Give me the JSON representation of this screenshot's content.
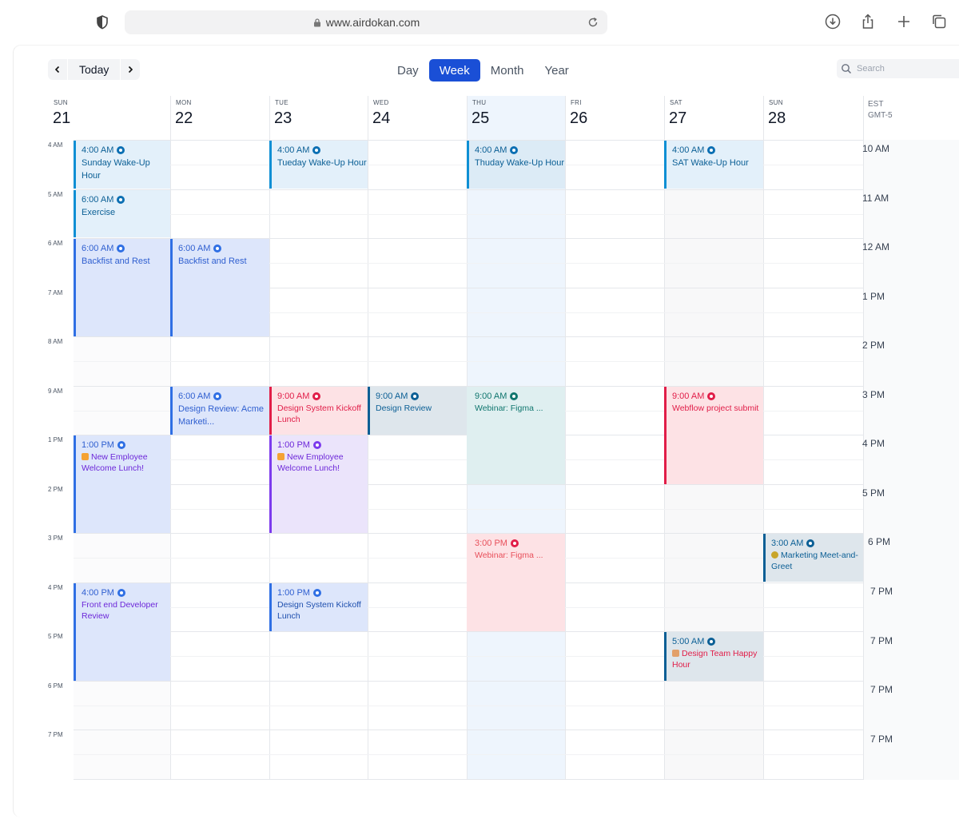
{
  "browser": {
    "url": "www.airdokan.com"
  },
  "toolbar": {
    "today_label": "Today",
    "views": [
      "Day",
      "Week",
      "Month",
      "Year"
    ],
    "active_view": "Week",
    "search_placeholder": "Search"
  },
  "days": [
    {
      "name": "SUN",
      "num": "21"
    },
    {
      "name": "MON",
      "num": "22"
    },
    {
      "name": "TUE",
      "num": "23"
    },
    {
      "name": "WED",
      "num": "24"
    },
    {
      "name": "THU",
      "num": "25"
    },
    {
      "name": "FRI",
      "num": "26"
    },
    {
      "name": "SAT",
      "num": "27"
    },
    {
      "name": "SUN",
      "num": "28"
    }
  ],
  "timezone": {
    "name": "EST",
    "offset": "GMT-5"
  },
  "time_labels": [
    "4 AM",
    "5 AM",
    "6 AM",
    "7 AM",
    "8 AM",
    "9 AM",
    "1 PM",
    "2 PM",
    "3 PM",
    "4 PM",
    "5 PM",
    "6 PM",
    "7 PM"
  ],
  "est_labels": [
    "10 AM",
    "11 AM",
    "12 AM",
    "1 PM",
    "2 PM",
    "3 PM",
    "4 PM",
    "5 PM",
    "6 PM",
    "7 PM",
    "7 PM",
    "7 PM",
    "7 PM"
  ],
  "events": [
    {
      "time": "4:00 AM",
      "title": "Sunday Wake-Up Hour"
    },
    {
      "time": "6:00 AM",
      "title": "Exercise"
    },
    {
      "time": "6:00 AM",
      "title": "Backfist and Rest"
    },
    {
      "time": "6:00 AM",
      "title": "Backfist and Rest"
    },
    {
      "time": "4:00 AM",
      "title": "Tueday Wake-Up Hour"
    },
    {
      "time": "4:00 AM",
      "title": "Thuday Wake-Up Hour"
    },
    {
      "time": "4:00 AM",
      "title": "SAT Wake-Up Hour"
    },
    {
      "time": "6:00 AM",
      "title": "Design Review: Acme Marketi..."
    },
    {
      "time": "9:00 AM",
      "title": "Design System Kickoff Lunch"
    },
    {
      "time": "9:00 AM",
      "title": "Design Review"
    },
    {
      "time": "9:00 AM",
      "title": "Webinar: Figma ..."
    },
    {
      "time": "9:00 AM",
      "title": "Webflow project submit"
    },
    {
      "time": "1:00 PM",
      "title": "New Employee Welcome Lunch!"
    },
    {
      "time": "1:00 PM",
      "title": "New Employee Welcome Lunch!"
    },
    {
      "time": "3:00 PM",
      "title": "Webinar: Figma ..."
    },
    {
      "time": "3:00 AM",
      "title": "Marketing Meet-and-Greet"
    },
    {
      "time": "4:00 PM",
      "title": "Front end Developer Review"
    },
    {
      "time": "1:00 PM",
      "title": "Design System Kickoff Lunch"
    },
    {
      "time": "5:00 AM",
      "title": "Design Team Happy Hour"
    }
  ],
  "colors": {
    "accent": "#1a4fd6",
    "blue_event": "#2f6fe4",
    "sky_event": "#0e8fd4",
    "red_event": "#e11d48",
    "purple_event": "#7c3aed",
    "teal_event": "#0f766e",
    "today_column": "#eef5fd"
  }
}
